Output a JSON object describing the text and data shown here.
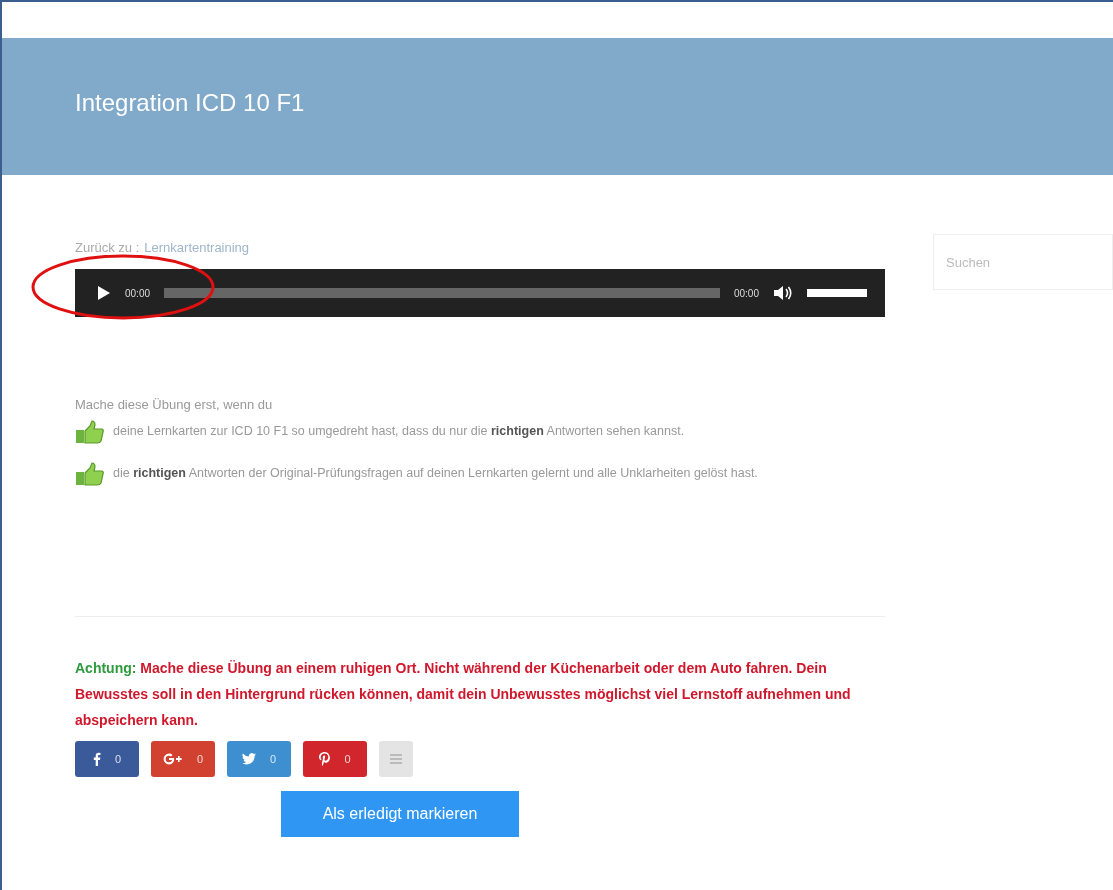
{
  "header": {
    "title": "Integration ICD 10 F1"
  },
  "breadcrumb": {
    "prefix": "Zurück zu :",
    "link": "Lernkartentraining"
  },
  "audio_player": {
    "current_time": "00:00",
    "duration": "00:00",
    "volume": {
      "level": 1
    }
  },
  "intro": "Mache diese Übung erst, wenn du",
  "conditions": [
    {
      "text": "deine Lernkarten zur ICD 10 F1 so umgedreht hast, dass du nur die **richtigen** Antworten sehen kannst."
    },
    {
      "text": "die **richtigen** Antworten der Original-Prüfungsfragen auf deinen Lernkarten gelernt und alle Unklarheiten gelöst hast."
    }
  ],
  "warning": {
    "label": "Achtung:",
    "text": "Mache diese Übung an einem ruhigen Ort. Nicht während der Küchenarbeit oder dem Auto fahren. Dein Bewusstes soll in den Hintergrund rücken können, damit dein Unbewusstes möglichst viel Lernstoff aufnehmen und abspeichern kann."
  },
  "share_buttons": [
    {
      "kind": "facebook",
      "count": "0",
      "color": "#3b5a9a"
    },
    {
      "kind": "google",
      "count": "0",
      "color": "#d2402f"
    },
    {
      "kind": "twitter",
      "count": "0",
      "color": "#3d8fcf"
    },
    {
      "kind": "pinterest",
      "count": "0",
      "color": "#d1262c"
    },
    {
      "kind": "more",
      "color": "#e4e4e4"
    }
  ],
  "complete_button": "Als erledigt markieren",
  "sidebar": {
    "search": {
      "placeholder": "Suchen"
    }
  }
}
